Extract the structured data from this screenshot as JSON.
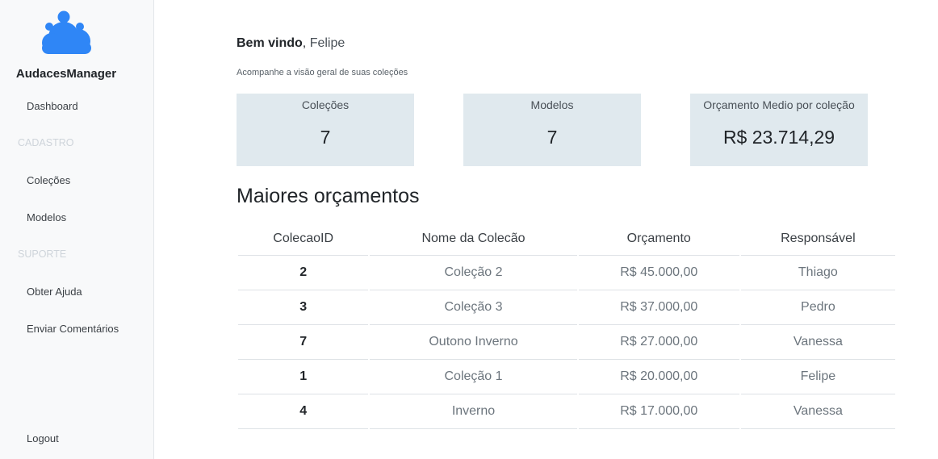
{
  "app": {
    "name": "AudacesManager",
    "logo_icon": "cloud-users-icon",
    "accent": "#2f86f6"
  },
  "sidebar": {
    "dashboard": "Dashboard",
    "section_cadastro": "CADASTRO",
    "colecoes": "Coleções",
    "modelos": "Modelos",
    "section_suporte": "SUPORTE",
    "ajuda": "Obter Ajuda",
    "comentarios": "Enviar Comentários",
    "logout": "Logout"
  },
  "header": {
    "welcome": "Bem vindo",
    "separator": ", ",
    "user": "Felipe",
    "subtitle": "Acompanhe a visão geral de suas coleções"
  },
  "cards": [
    {
      "label": "Coleções",
      "value": "7"
    },
    {
      "label": "Modelos",
      "value": "7"
    },
    {
      "label": "Orçamento Medio por coleção",
      "value": "R$ 23.714,29"
    }
  ],
  "ranking": {
    "title": "Maiores orçamentos",
    "columns": [
      "ColecaoID",
      "Nome da Colecão",
      "Orçamento",
      "Responsável"
    ],
    "rows": [
      [
        "2",
        "Coleção 2",
        "R$ 45.000,00",
        "Thiago"
      ],
      [
        "3",
        "Coleção 3",
        "R$ 37.000,00",
        "Pedro"
      ],
      [
        "7",
        "Outono Inverno",
        "R$ 27.000,00",
        "Vanessa"
      ],
      [
        "1",
        "Coleção 1",
        "R$ 20.000,00",
        "Felipe"
      ],
      [
        "4",
        "Inverno",
        "R$ 17.000,00",
        "Vanessa"
      ]
    ]
  }
}
